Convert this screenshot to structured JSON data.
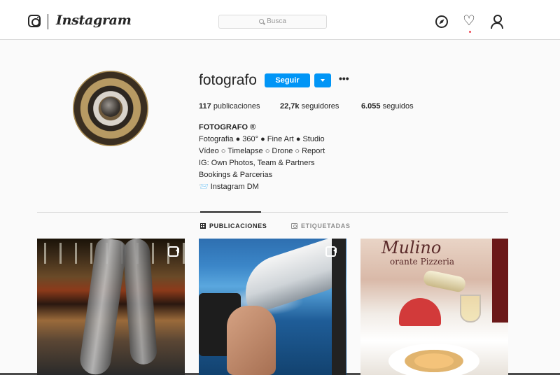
{
  "nav": {
    "logo_text": "Instagram",
    "search_placeholder": "Busca"
  },
  "profile": {
    "username": "fotografo",
    "follow_label": "Seguir",
    "more_label": "•••",
    "stats": {
      "posts_count": "117",
      "posts_label": "publicaciones",
      "followers_count": "22,7k",
      "followers_label": "seguidores",
      "following_count": "6.055",
      "following_label": "seguidos"
    },
    "bio": {
      "name": "FOTOGRAFO ®",
      "lines": [
        "Fotografia ● 360° ● Fine Art ● Studio",
        "Vídeo ○ Timelapse ○ Drone ○ Report",
        "IG: Own Photos, Team & Partners",
        "Bookings & Parcerias",
        "📨 Instagram DM"
      ]
    }
  },
  "tabs": {
    "publicaciones": "PUBLICACIONES",
    "etiquetadas": "ETIQUETADAS"
  },
  "posts": {
    "sign_title": "Mulino",
    "sign_subtitle": "orante Pizzeria"
  },
  "colors": {
    "follow_button": "#0095f6",
    "notification_dot": "#ed4956"
  }
}
